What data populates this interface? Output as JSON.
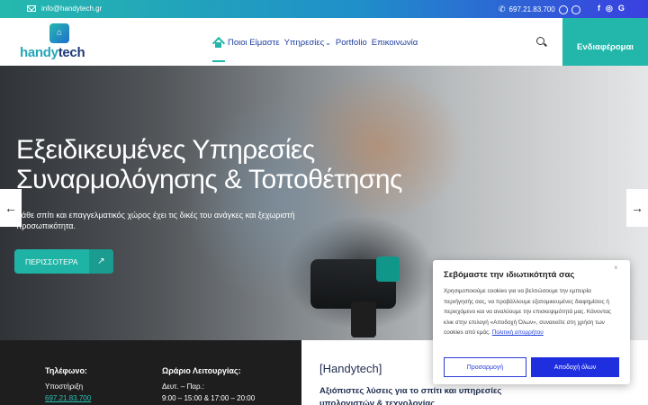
{
  "topbar": {
    "email": "info@handytech.gr",
    "phone": "697.21.83.700",
    "social": [
      "f",
      "◎",
      "G"
    ]
  },
  "logo": {
    "part1": "handy",
    "part2": "tech"
  },
  "nav": {
    "items": [
      "Ποιοι Είμαστε",
      "Υπηρεσίες",
      "Portfolio",
      "Επικοινωνία"
    ],
    "dropdown_marker": "⌄"
  },
  "cta_label": "Ενδιαφέρομαι",
  "hero": {
    "title": "Εξειδικευμένες Υπηρεσίες Συναρμολόγησης & Τοποθέτησης",
    "subtitle": "Κάθε σπίτι και επαγγελματικός χώρος έχει τις δικές του ανάγκες και ξεχωριστή προσωπικότητα.",
    "button_label": "ΠΕΡΙΣΣΟΤΕΡΑ",
    "button_arrow": "↗"
  },
  "slider": {
    "prev": "←",
    "next": "→"
  },
  "info": {
    "phone_heading": "Τηλέφωνο:",
    "phone_label": "Υποστήριξη",
    "phone_value": "697.21.83.700",
    "hours_heading": "Ωράριο Λειτουργίας:",
    "hours_days": "Δευτ. – Παρ.:",
    "hours_times": "9:00 – 15:00 & 17:00 – 20:00",
    "brand_title": "[Handytech]",
    "brand_desc": "Αξιόπιστες λύσεις για το σπίτι και υπηρεσίες υπολογιστών & τεχνολογίας"
  },
  "cookie": {
    "title": "Σεβόμαστε την ιδιωτικότητά σας",
    "close": "×",
    "body": "Χρησιμοποιούμε cookies για να βελτιώσουμε την εμπειρία περιήγησής σας, να προβάλλουμε εξατομικευμένες διαφημίσεις ή περιεχόμενο και να αναλύουμε την επισκεψιμότητά μας. Κάνοντας κλικ στην επιλογή «Αποδοχή Όλων», συναινείτε στη χρήση των cookies από εμάς.",
    "policy_link": "Πολιτική απορρήτου",
    "customize_label": "Προσαρμογή",
    "accept_label": "Αποδοχή όλων"
  }
}
